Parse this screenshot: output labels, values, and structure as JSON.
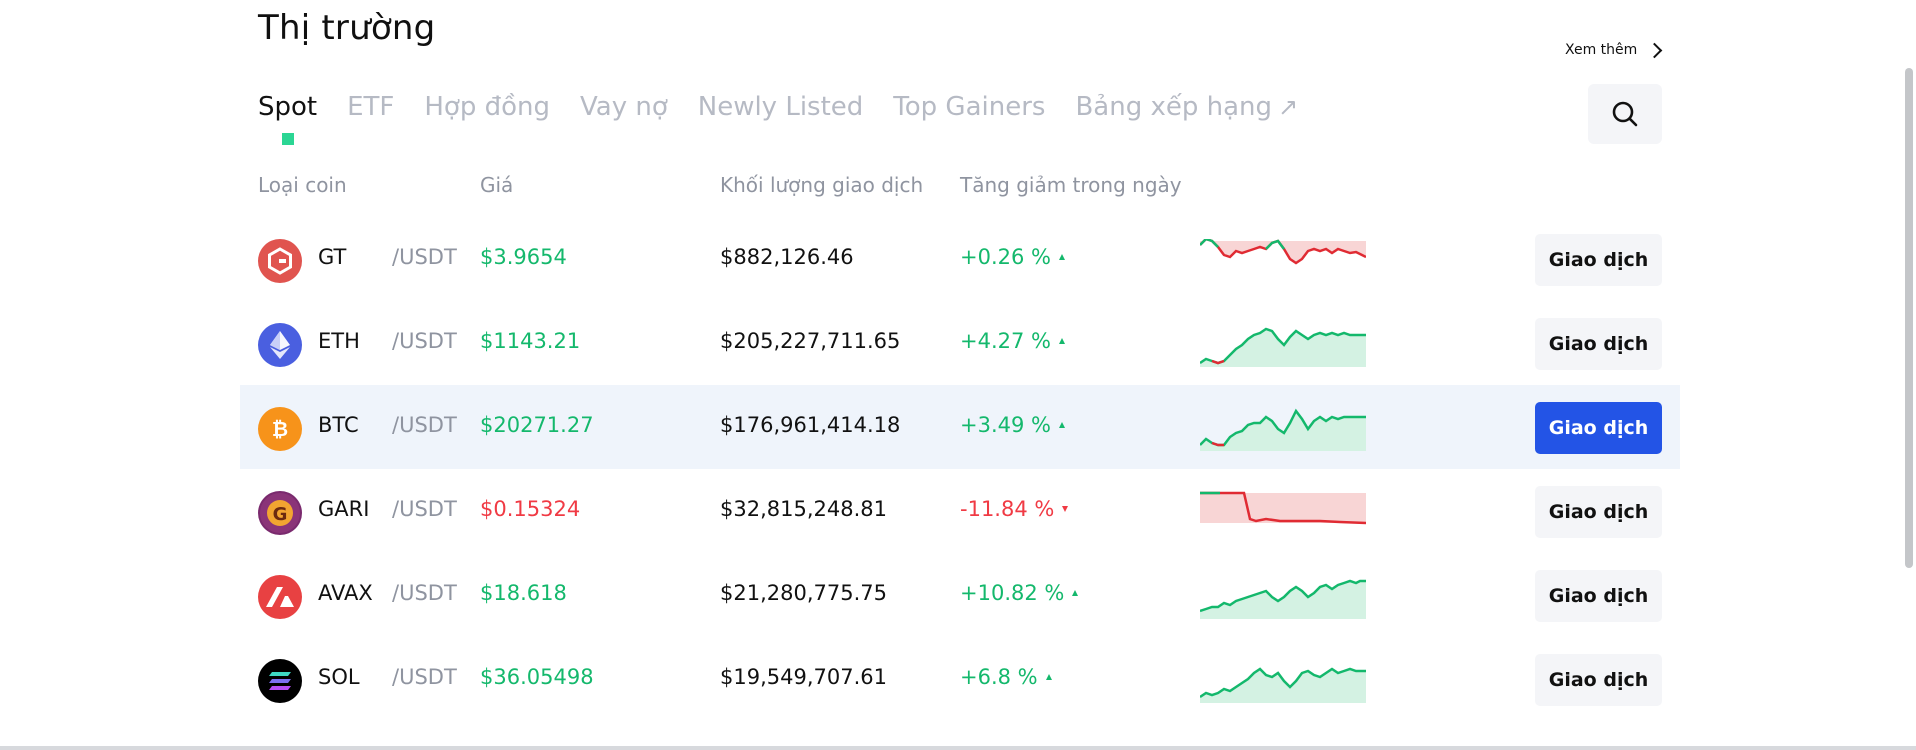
{
  "header": {
    "title": "Thị trường",
    "more_label": "Xem thêm"
  },
  "tabs": [
    {
      "label": "Spot",
      "active": true
    },
    {
      "label": "ETF",
      "active": false
    },
    {
      "label": "Hợp đồng",
      "active": false
    },
    {
      "label": "Vay nợ",
      "active": false
    },
    {
      "label": "Newly Listed",
      "active": false
    },
    {
      "label": "Top Gainers",
      "active": false
    },
    {
      "label": "Bảng xếp hạng",
      "active": false,
      "external": true
    }
  ],
  "columns": {
    "coin": "Loại coin",
    "price": "Giá",
    "volume": "Khối lượng giao dịch",
    "change": "Tăng giảm trong ngày"
  },
  "rows": [
    {
      "symbol": "GT",
      "quote": "/USDT",
      "price": "$3.9654",
      "volume": "$882,126.46",
      "change": "+0.26 %",
      "direction": "up",
      "icon": "gt-coin-icon",
      "action": "Giao dịch",
      "highlighted": false
    },
    {
      "symbol": "ETH",
      "quote": "/USDT",
      "price": "$1143.21",
      "volume": "$205,227,711.65",
      "change": "+4.27 %",
      "direction": "up",
      "icon": "eth-coin-icon",
      "action": "Giao dịch",
      "highlighted": false
    },
    {
      "symbol": "BTC",
      "quote": "/USDT",
      "price": "$20271.27",
      "volume": "$176,961,414.18",
      "change": "+3.49 %",
      "direction": "up",
      "icon": "btc-coin-icon",
      "action": "Giao dịch",
      "highlighted": true
    },
    {
      "symbol": "GARI",
      "quote": "/USDT",
      "price": "$0.15324",
      "volume": "$32,815,248.81",
      "change": "-11.84 %",
      "direction": "down",
      "icon": "gari-coin-icon",
      "action": "Giao dịch",
      "highlighted": false
    },
    {
      "symbol": "AVAX",
      "quote": "/USDT",
      "price": "$18.618",
      "volume": "$21,280,775.75",
      "change": "+10.82 %",
      "direction": "up",
      "icon": "avax-coin-icon",
      "action": "Giao dịch",
      "highlighted": false
    },
    {
      "symbol": "SOL",
      "quote": "/USDT",
      "price": "$36.05498",
      "volume": "$19,549,707.61",
      "change": "+6.8 %",
      "direction": "up",
      "icon": "sol-coin-icon",
      "action": "Giao dịch",
      "highlighted": false
    }
  ],
  "colors": {
    "up": "#14b86c",
    "down": "#f03a44",
    "accent": "#2354e6",
    "tab_indicator": "#2bd694"
  }
}
